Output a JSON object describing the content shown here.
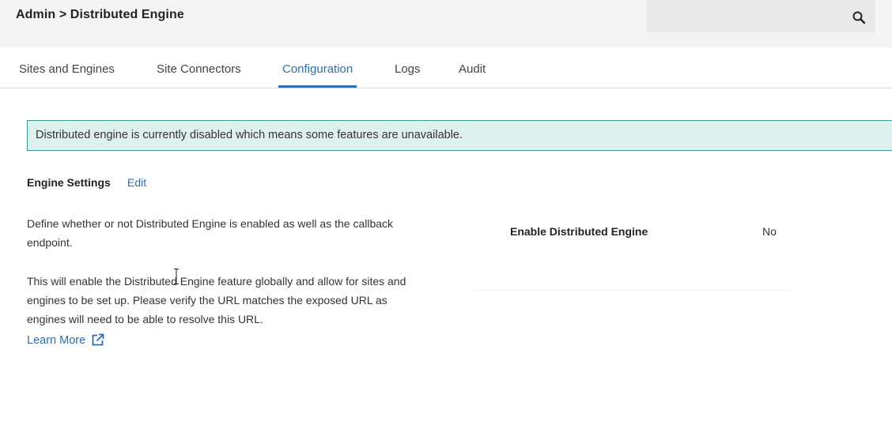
{
  "header": {
    "breadcrumb": "Admin > Distributed Engine",
    "search_icon": "search-icon"
  },
  "tabs": [
    {
      "label": "Sites and Engines",
      "active": false
    },
    {
      "label": "Site Connectors",
      "active": false
    },
    {
      "label": "Configuration",
      "active": true
    },
    {
      "label": "Logs",
      "active": false
    },
    {
      "label": "Audit",
      "active": false
    }
  ],
  "alert": {
    "text": "Distributed engine is currently disabled which means some features are unavailable."
  },
  "engine_settings": {
    "title": "Engine Settings",
    "edit_label": "Edit",
    "description_1": "Define whether or not Distributed Engine is enabled as well as the callback endpoint.",
    "description_2": "This will enable the Distributed Engine feature globally and allow for sites and engines to be set up. Please verify the URL matches the exposed URL as engines will need to be able to resolve this URL.",
    "learn_more_label": "Learn More",
    "learn_more_icon": "external-link-icon",
    "settings": [
      {
        "label": "Enable Distributed Engine",
        "value": "No"
      }
    ]
  },
  "colors": {
    "accent": "#2f6db5",
    "alert_background": "#dff1ef",
    "alert_border": "#3e9a92",
    "header_background": "#f4f4f4"
  }
}
